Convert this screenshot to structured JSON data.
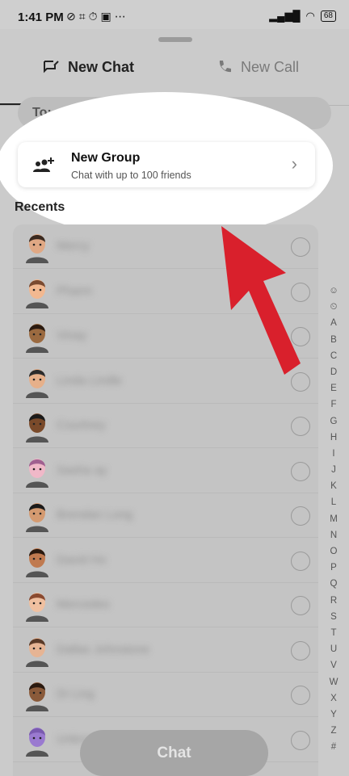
{
  "status_bar": {
    "time": "1:41 PM",
    "icons_left": [
      "muted-icon",
      "grid-icon",
      "alarm-icon",
      "sim-icon",
      "more-icon"
    ],
    "signal_icon": "signal-icon",
    "wifi_icon": "wifi-icon",
    "battery": "68"
  },
  "tabs": {
    "new_chat": "New Chat",
    "new_call": "New Call"
  },
  "to_field": {
    "label": "To:",
    "placeholder": ""
  },
  "new_group": {
    "title": "New Group",
    "subtitle": "Chat with up to 100 friends"
  },
  "recents_label": "Recents",
  "friends": [
    {
      "name": "Mercy"
    },
    {
      "name": "Pharm"
    },
    {
      "name": "Vinay"
    },
    {
      "name": "Linda Lindle"
    },
    {
      "name": "Courtney"
    },
    {
      "name": "Sasha ay"
    },
    {
      "name": "Brendan Long"
    },
    {
      "name": "David Ho"
    },
    {
      "name": "Mercedes"
    },
    {
      "name": "Dallas Johnstone"
    },
    {
      "name": "Di Ling"
    },
    {
      "name": "Unknown"
    }
  ],
  "alpha_index": [
    "☺",
    "⏲",
    "A",
    "B",
    "C",
    "D",
    "E",
    "F",
    "G",
    "H",
    "I",
    "J",
    "K",
    "L",
    "M",
    "N",
    "O",
    "P",
    "Q",
    "R",
    "S",
    "T",
    "U",
    "V",
    "W",
    "X",
    "Y",
    "Z",
    "#"
  ],
  "chat_button": "Chat",
  "colors": {
    "arrow": "#d9202c",
    "overlay": "#cbcbcb",
    "card": "#ffffff"
  }
}
